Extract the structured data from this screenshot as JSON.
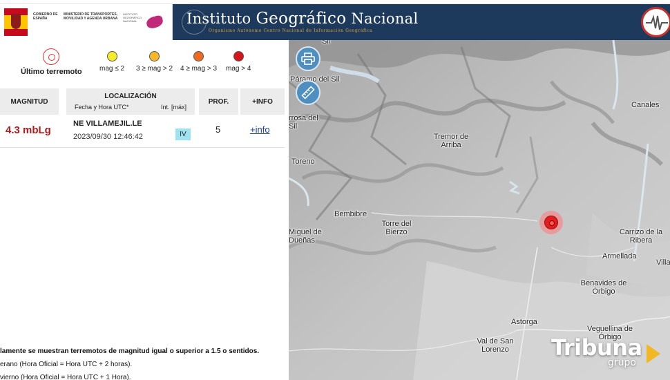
{
  "header": {
    "gov_text": "GOBIERNO DE ESPAÑA",
    "ministry_text": "MINISTERIO DE TRANSPORTES, MOVILIDAD Y AGENDA URBANA",
    "ign_small_text": "INSTITUTO GEOGRÁFICO NACIONAL",
    "title_part1": "Instituto ",
    "title_part2": "Geográfico",
    "title_part3": " Nacional",
    "subtitle": "Organismo Autónomo   Centro Nacional de Información Geográfica"
  },
  "legend": {
    "last_quake_label": "Último terremoto",
    "items": [
      {
        "label": "mag ≤ 2",
        "color": "#f7ea2a"
      },
      {
        "label": "3 ≥ mag > 2",
        "color": "#f5b829"
      },
      {
        "label": "4 ≥ mag > 3",
        "color": "#ef6a21"
      },
      {
        "label": "mag > 4",
        "color": "#d4151b"
      }
    ]
  },
  "table": {
    "headers": {
      "magnitude": "MAGNITUD",
      "location": "LOCALIZACIÓN",
      "datetime": "Fecha y Hora UTC*",
      "intensity": "Int. [máx]",
      "depth": "PROF.",
      "info": "+INFO"
    },
    "rows": [
      {
        "magnitude": "4.3 mbLg",
        "location": "NE VILLAMEJIL.LE",
        "datetime": "2023/09/30 12:46:42",
        "intensity": "IV",
        "depth": "5",
        "info": "+info"
      }
    ]
  },
  "footnotes": [
    "lamente se muestran terremotos de magnitud igual o superior a 1.5 o sentidos.",
    "erano (Hora Oficial = Hora UTC + 2 horas).",
    "vierno (Hora Oficial = Hora UTC + 1 Hora)."
  ],
  "map": {
    "places": [
      "Páramo del Sil",
      "rrosa del Sil",
      "Toreno",
      "Tremor de Arriba",
      "Bembibre",
      "Torre del Bierzo",
      "Miguel de Dueñas",
      "Canales",
      "Carrizo de la Ribera",
      "Armellada",
      "Villa",
      "Benavides de Órbigo",
      "Astorga",
      "Veguellina de Órbigo",
      "Val de San Lorenzo",
      "Sil"
    ],
    "print_icon": "printer-icon",
    "measure_icon": "ruler-icon"
  },
  "watermark": {
    "brand": "Tribuna",
    "sub": "grupo"
  }
}
